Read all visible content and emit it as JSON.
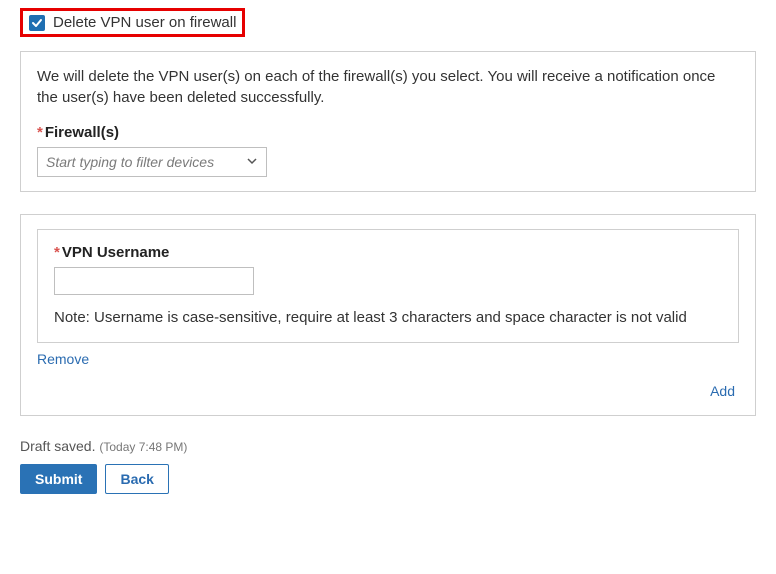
{
  "checkbox": {
    "label": "Delete VPN user on firewall",
    "checked": true
  },
  "panel1": {
    "description": "We will delete the VPN user(s) on each of the firewall(s) you select. You will receive a notification once the user(s) have been deleted successfully.",
    "firewall": {
      "label": "Firewall(s)",
      "placeholder": "Start typing to filter devices"
    }
  },
  "panel2": {
    "username": {
      "label": "VPN Username",
      "value": "",
      "note": "Note: Username is case-sensitive, require at least 3 characters and space character is not valid"
    },
    "remove_label": "Remove",
    "add_label": "Add"
  },
  "footer": {
    "draft_label": "Draft saved.",
    "draft_time": "(Today 7:48 PM)",
    "submit_label": "Submit",
    "back_label": "Back"
  }
}
